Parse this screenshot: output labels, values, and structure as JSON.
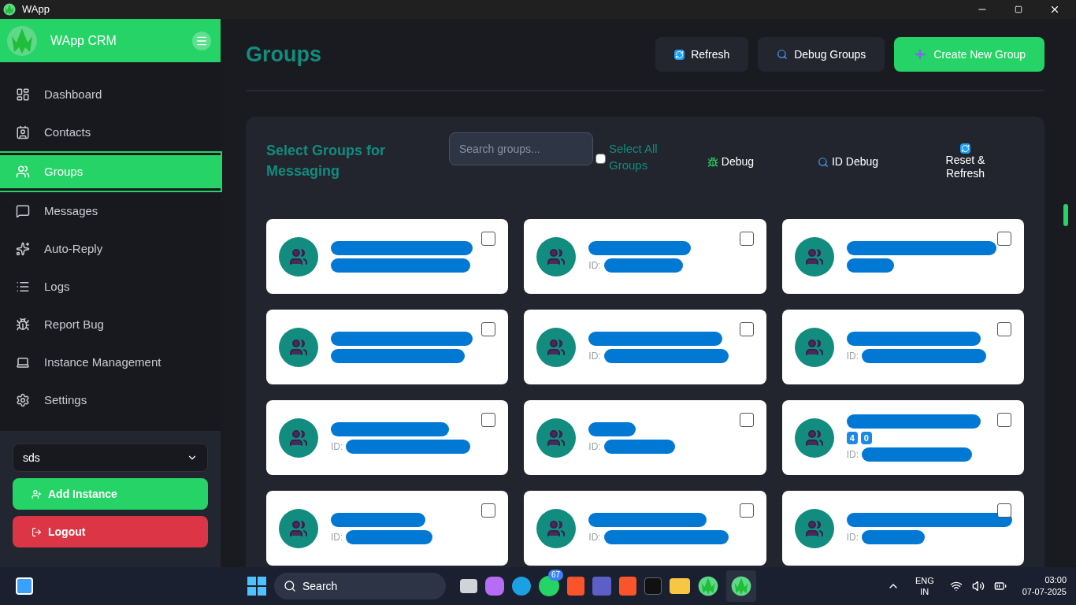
{
  "window": {
    "title": "WApp"
  },
  "sidebar": {
    "brand": "WApp CRM",
    "items": [
      {
        "label": "Dashboard",
        "selected": false
      },
      {
        "label": "Contacts",
        "selected": false
      },
      {
        "label": "Groups",
        "selected": true
      },
      {
        "label": "Messages",
        "selected": false
      },
      {
        "label": "Auto-Reply",
        "selected": false
      },
      {
        "label": "Logs",
        "selected": false
      },
      {
        "label": "Report Bug",
        "selected": false
      },
      {
        "label": "Instance Management",
        "selected": false
      },
      {
        "label": "Settings",
        "selected": false
      }
    ],
    "instance_select": {
      "value": "sds"
    },
    "buttons": [
      {
        "kind": "add",
        "label": "Add Instance"
      },
      {
        "kind": "logout",
        "label": "Logout"
      }
    ]
  },
  "page": {
    "title": "Groups",
    "actions": [
      {
        "kind": "refresh",
        "label": "Refresh"
      },
      {
        "kind": "debug",
        "label": "Debug Groups"
      },
      {
        "kind": "create",
        "label": "Create New Group"
      }
    ]
  },
  "panel": {
    "title": "Select Groups for Messaging",
    "search": {
      "placeholder": "Search groups..."
    },
    "select_all": {
      "label": "Select All Groups",
      "checked": false
    },
    "tools": [
      {
        "kind": "bug",
        "label": "Debug"
      },
      {
        "kind": "search",
        "label": "ID Debug"
      },
      {
        "kind": "refresh",
        "label": "Reset & Refresh"
      }
    ],
    "groups": [
      {
        "kind": "redacted",
        "checked": false
      },
      {
        "kind": "redacted",
        "id_label": "ID:",
        "checked": false
      },
      {
        "kind": "redacted",
        "checked": false
      },
      {
        "kind": "redacted",
        "checked": false
      },
      {
        "kind": "redacted",
        "id_label": "ID:",
        "checked": false
      },
      {
        "kind": "redacted",
        "id_label": "ID:",
        "checked": false
      },
      {
        "kind": "redacted",
        "id_label": "ID:",
        "checked": false
      },
      {
        "kind": "redacted",
        "id_label": "ID:",
        "checked": false
      },
      {
        "kind": "redacted",
        "id_label": "ID:",
        "badges": [
          "4",
          "0"
        ],
        "checked": false
      },
      {
        "kind": "redacted",
        "id_label": "ID:",
        "checked": false
      },
      {
        "kind": "redacted",
        "id_label": "ID:",
        "checked": false
      },
      {
        "kind": "redacted",
        "id_label": "ID:",
        "checked": false
      }
    ]
  },
  "taskbar": {
    "search": "Search",
    "whatsapp_badge": "67",
    "language": "ENG",
    "region": "IN",
    "time": "03:00",
    "date": "07-07-2025"
  }
}
